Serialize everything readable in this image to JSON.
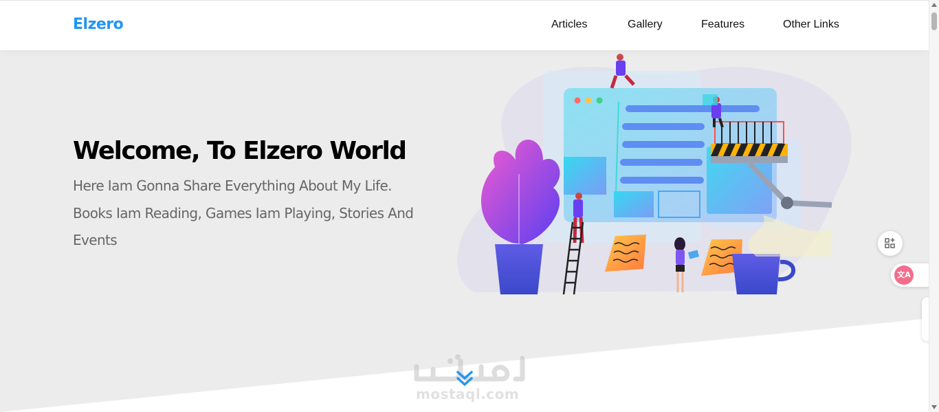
{
  "header": {
    "logo": "Elzero",
    "nav": [
      "Articles",
      "Gallery",
      "Features",
      "Other Links"
    ]
  },
  "landing": {
    "title": "Welcome, To Elzero World",
    "description": "Here Iam Gonna Share Everything About My Life. Books Iam Reading, Games Iam Playing, Stories And Events"
  },
  "watermark": {
    "text": "mostaql.com"
  },
  "colors": {
    "brand": "#2196f3",
    "background": "#ececec",
    "text_muted": "#666666"
  },
  "icons": {
    "go_down": "double-chevron-down-icon",
    "grid_widget": "grid-plus-icon",
    "translate_widget": "translate-icon"
  }
}
